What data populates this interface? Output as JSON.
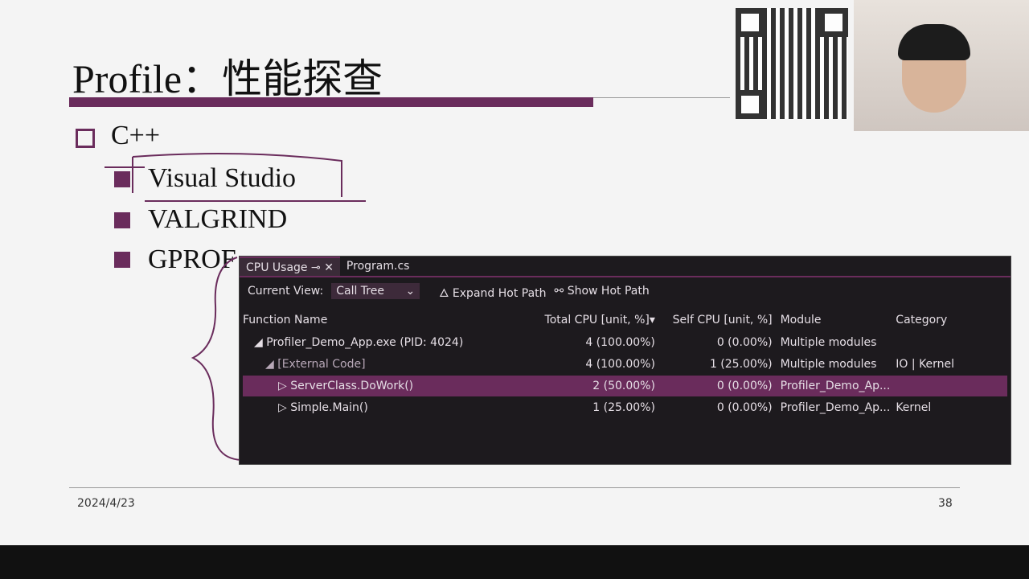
{
  "slide": {
    "title": "Profile：性能探查",
    "level1": "C++",
    "items": [
      "Visual Studio",
      "VALGRIND",
      "GPROF"
    ],
    "date": "2024/4/23",
    "page": "38"
  },
  "panel": {
    "tabs": [
      {
        "label": "CPU Usage"
      },
      {
        "label": "Program.cs"
      }
    ],
    "toolbar": {
      "current_view_label": "Current View:",
      "view_value": "Call Tree",
      "expand_hot_path": "Expand Hot Path",
      "show_hot_path": "Show Hot Path"
    },
    "columns": [
      "Function Name",
      "Total CPU [unit, %]",
      "Self CPU [unit, %]",
      "Module",
      "Category"
    ],
    "rows": [
      {
        "name": "Profiler_Demo_App.exe (PID: 4024)",
        "total": "4 (100.00%)",
        "self": "0 (0.00%)",
        "module": "Multiple modules",
        "category": ""
      },
      {
        "name": "[External Code]",
        "total": "4 (100.00%)",
        "self": "1 (25.00%)",
        "module": "Multiple modules",
        "category": "IO | Kernel"
      },
      {
        "name": "ServerClass.DoWork()",
        "total": "2 (50.00%)",
        "self": "0 (0.00%)",
        "module": "Profiler_Demo_Ap...",
        "category": ""
      },
      {
        "name": "Simple.Main()",
        "total": "1 (25.00%)",
        "self": "0 (0.00%)",
        "module": "Profiler_Demo_Ap...",
        "category": "Kernel"
      }
    ]
  },
  "colors": {
    "accent": "#6a2c5c",
    "panel_bg": "#1d1a1e"
  }
}
